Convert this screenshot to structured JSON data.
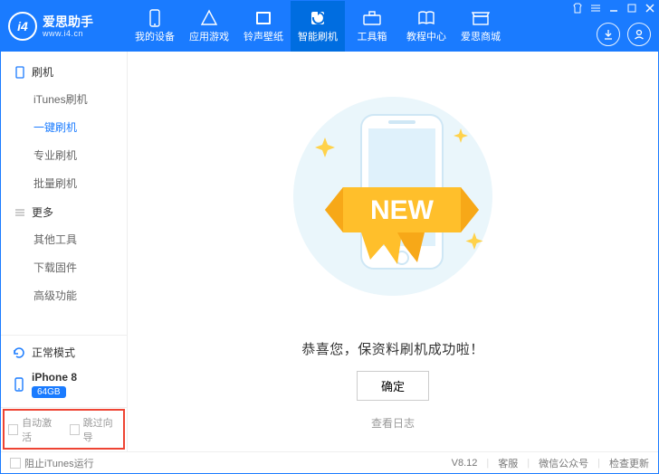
{
  "logo": {
    "initials": "i4",
    "name": "爱思助手",
    "url": "www.i4.cn"
  },
  "nav": {
    "items": [
      {
        "label": "我的设备"
      },
      {
        "label": "应用游戏"
      },
      {
        "label": "铃声壁纸"
      },
      {
        "label": "智能刷机"
      },
      {
        "label": "工具箱"
      },
      {
        "label": "教程中心"
      },
      {
        "label": "爱思商城"
      }
    ]
  },
  "sidebar": {
    "groups": [
      {
        "title": "刷机",
        "items": [
          {
            "label": "iTunes刷机"
          },
          {
            "label": "一键刷机",
            "active": true
          },
          {
            "label": "专业刷机"
          },
          {
            "label": "批量刷机"
          }
        ]
      },
      {
        "title": "更多",
        "items": [
          {
            "label": "其他工具"
          },
          {
            "label": "下载固件"
          },
          {
            "label": "高级功能"
          }
        ]
      }
    ],
    "mode": "正常模式",
    "device": {
      "name": "iPhone 8",
      "storage": "64GB"
    },
    "opts": {
      "auto_activate": "自动激活",
      "skip_setup": "跳过向导"
    }
  },
  "main": {
    "success_msg": "恭喜您，保资料刷机成功啦！",
    "ok_label": "确定",
    "view_log": "查看日志",
    "ribbon": "NEW"
  },
  "footer": {
    "block_itunes": "阻止iTunes运行",
    "version": "V8.12",
    "support": "客服",
    "wechat": "微信公众号",
    "check_update": "检查更新"
  }
}
